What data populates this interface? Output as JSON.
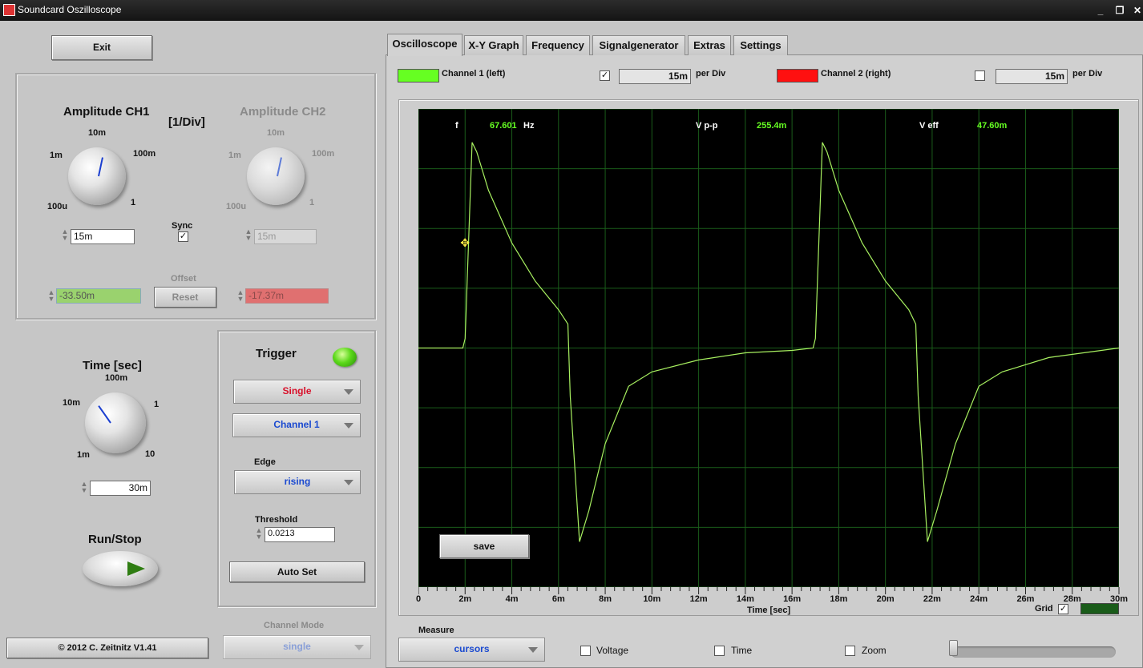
{
  "window": {
    "title": "Soundcard Oszilloscope"
  },
  "left": {
    "exit_label": "Exit",
    "amp_ch1_title": "Amplitude CH1",
    "amp_ch2_title": "Amplitude CH2",
    "div_unit": "[1/Div]",
    "ch1_scale": [
      "100u",
      "1m",
      "10m",
      "100m",
      "1"
    ],
    "ch2_scale": [
      "100u",
      "1m",
      "10m",
      "100m",
      "1"
    ],
    "sync_label": "Sync",
    "sync_checked": "✓",
    "ch1_amp_value": "15m",
    "ch2_amp_value": "15m",
    "offset_label": "Offset",
    "ch1_offset_value": "-33.50m",
    "ch2_offset_value": "-17.37m",
    "reset_label": "Reset",
    "time_title": "Time [sec]",
    "time_scale": [
      "1m",
      "10m",
      "100m",
      "1",
      "10"
    ],
    "time_value": "30m",
    "runstop_label": "Run/Stop",
    "copyright": "© 2012  C. Zeitnitz V1.41",
    "channel_mode_label": "Channel Mode",
    "channel_mode_value": "single"
  },
  "trigger": {
    "title": "Trigger",
    "mode": "Single",
    "channel": "Channel 1",
    "edge_label": "Edge",
    "edge": "rising",
    "threshold_label": "Threshold",
    "threshold": "0.0213",
    "autoset_label": "Auto Set"
  },
  "tabs": [
    "Oscilloscope",
    "X-Y Graph",
    "Frequency",
    "Signalgenerator",
    "Extras",
    "Settings"
  ],
  "channels": {
    "ch1_label": "Channel 1 (left)",
    "ch1_color": "#66ff22",
    "ch1_checked": "✓",
    "ch1_per_div": "15m",
    "ch2_label": "Channel 2 (right)",
    "ch2_color": "#ff1010",
    "ch2_checked": "",
    "ch2_per_div": "15m",
    "per_div_label": "per Div"
  },
  "measurements": {
    "f_label": "f",
    "f_value": "67.601",
    "f_unit": "Hz",
    "vpp_label": "V p-p",
    "vpp_value": "255.4m",
    "veff_label": "V eff",
    "veff_value": "47.60m"
  },
  "scope": {
    "save_label": "save",
    "x_label": "Time [sec]",
    "grid_label": "Grid",
    "grid_checked": "✓",
    "grid_color": "#1a5c1a",
    "trace_color": "#a8f060"
  },
  "bottom": {
    "measure_label": "Measure",
    "measure_value": "cursors",
    "voltage_label": "Voltage",
    "time_label": "Time",
    "zoom_label": "Zoom"
  },
  "chart_data": {
    "type": "line",
    "xlabel": "Time [sec]",
    "xlim": [
      0,
      30
    ],
    "x_ticks": [
      "0",
      "2m",
      "4m",
      "6m",
      "8m",
      "10m",
      "12m",
      "14m",
      "16m",
      "18m",
      "20m",
      "22m",
      "24m",
      "26m",
      "28m",
      "30m"
    ],
    "ylim": [
      -5,
      5
    ],
    "series": [
      {
        "x": [
          0,
          1.9,
          2.0,
          2.3,
          2.5,
          3.0,
          4.0,
          5.0,
          6.0,
          6.4,
          6.5,
          6.9,
          7.3,
          8.0,
          9.0,
          10.0,
          12.0,
          14.0,
          16.0,
          16.9,
          17.0,
          17.3,
          17.5,
          18.0,
          19.0,
          20.0,
          21.0,
          21.3,
          21.4,
          21.8,
          22.2,
          23.0,
          24.0,
          25.0,
          27.0,
          30.0
        ],
        "y": [
          0.0,
          0.0,
          0.2,
          4.3,
          4.1,
          3.3,
          2.2,
          1.4,
          0.8,
          0.5,
          -1.0,
          -4.05,
          -3.4,
          -2.0,
          -0.8,
          -0.5,
          -0.25,
          -0.1,
          -0.05,
          0.0,
          0.2,
          4.3,
          4.1,
          3.3,
          2.2,
          1.4,
          0.8,
          0.5,
          -1.0,
          -4.05,
          -3.4,
          -2.0,
          -0.8,
          -0.5,
          -0.2,
          0.0
        ]
      }
    ]
  }
}
